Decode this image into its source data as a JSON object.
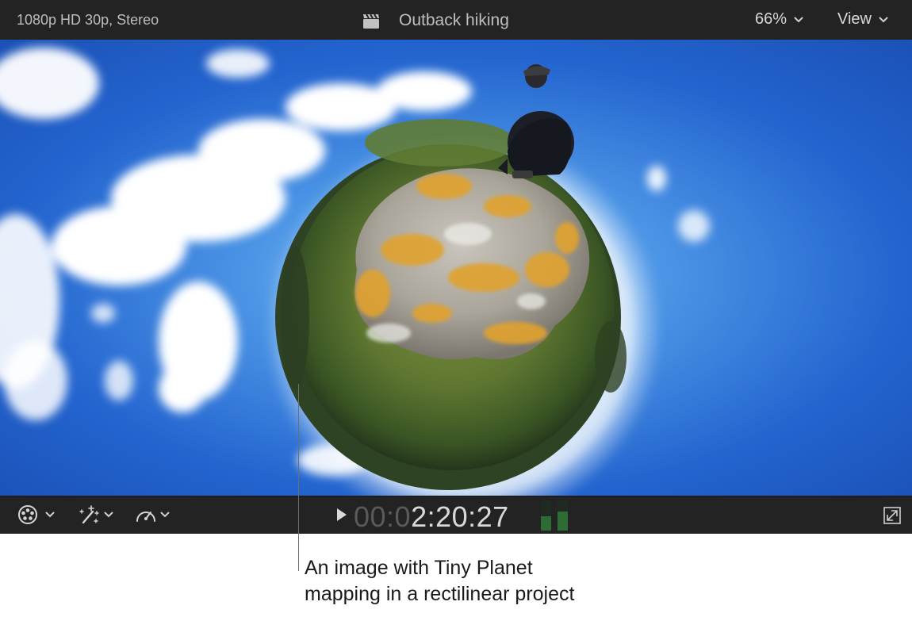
{
  "viewer": {
    "format": "1080p HD 30p, Stereo",
    "project_title": "Outback hiking",
    "zoom": "66%",
    "view_menu": "View",
    "timecode_dim": "00:0",
    "timecode_lit": "2:20:27"
  },
  "icons": {
    "title": "clapperboard-icon",
    "zoom": "chevron-down-icon",
    "color_board": "color-wheel-icon",
    "enhancements": "magic-wand-icon",
    "retime": "speedometer-icon",
    "play": "play-icon",
    "audio_meters": "audio-meter-icon",
    "fullscreen": "fullscreen-icon"
  },
  "callout": {
    "line1": "An image with Tiny Planet",
    "line2": "mapping in a rectilinear project"
  },
  "colors": {
    "toolbar_bg": "#232323",
    "sky": "#2f6fd8",
    "text_light": "#d9d9d9",
    "timecode_dim": "#5a5a5a",
    "meter_green": "#2f6b34"
  }
}
